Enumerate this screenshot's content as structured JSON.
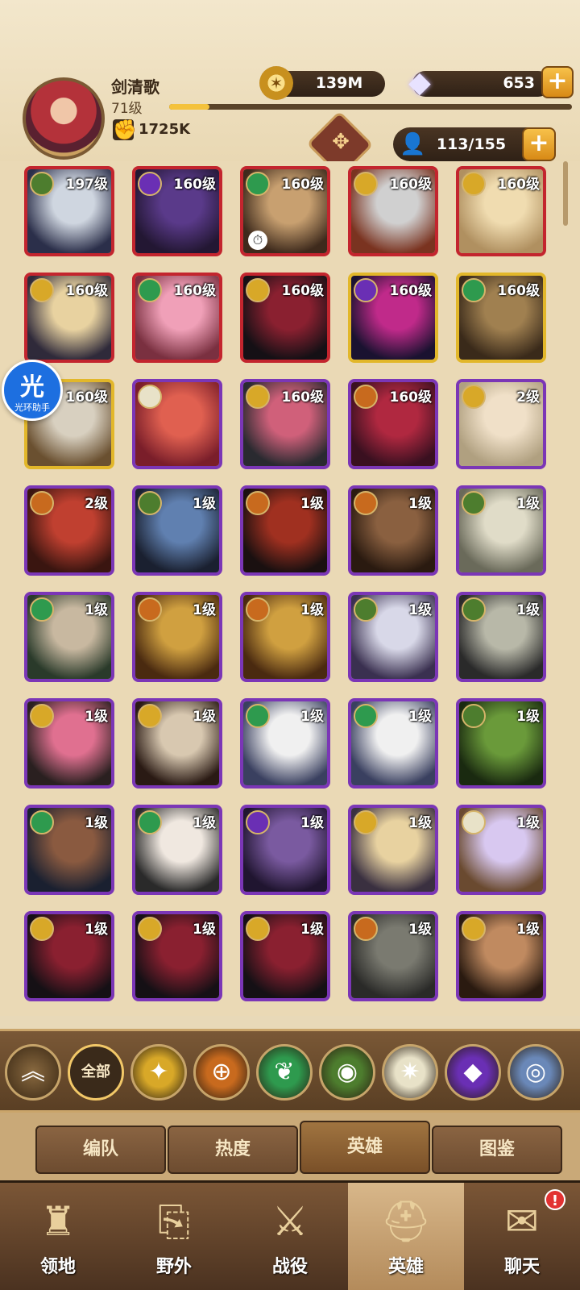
{
  "player": {
    "name": "剑清歌",
    "level": "71级",
    "xp_fraction": 0.1,
    "power": "1725K"
  },
  "currency": {
    "gold": "139M",
    "gems": "653",
    "add_glyph": "+"
  },
  "roster": {
    "capacity": "113/155",
    "add_glyph": "+"
  },
  "assistant": {
    "glyph": "光",
    "label": "光环助手"
  },
  "colors": {
    "lightbearer": "#d8a828",
    "mauler": "#c86a1e",
    "wilder": "#2e9a4e",
    "graveborn": "#4d7d2e",
    "celestial": "#e8e2c8",
    "hypogean": "#6a2fb4",
    "dimensional": "#6a88b8"
  },
  "heroes": [
    {
      "level": "197级",
      "faction": "graveborn",
      "frame": "red",
      "portrait": [
        "#cfd6e0",
        "#2b2f4a"
      ],
      "clock": false
    },
    {
      "level": "160级",
      "faction": "hypogean",
      "frame": "red",
      "portrait": [
        "#5a3a8a",
        "#231733"
      ],
      "clock": false
    },
    {
      "level": "160级",
      "faction": "wilder",
      "frame": "red",
      "portrait": [
        "#c8a070",
        "#3e2a1c"
      ],
      "clock": true
    },
    {
      "level": "160级",
      "faction": "lightbearer",
      "frame": "red",
      "portrait": [
        "#d0d0d0",
        "#7a3320"
      ],
      "clock": false
    },
    {
      "level": "160级",
      "faction": "lightbearer",
      "frame": "red",
      "portrait": [
        "#f0dcb0",
        "#b09060"
      ],
      "clock": false
    },
    {
      "level": "160级",
      "faction": "lightbearer",
      "frame": "red",
      "portrait": [
        "#e8d2a0",
        "#2f2a3a"
      ],
      "clock": false
    },
    {
      "level": "160级",
      "faction": "wilder",
      "frame": "red",
      "portrait": [
        "#f0a0b8",
        "#7a3040"
      ],
      "clock": false
    },
    {
      "level": "160级",
      "faction": "lightbearer",
      "frame": "red",
      "portrait": [
        "#8a2030",
        "#151015"
      ],
      "clock": false
    },
    {
      "level": "160级",
      "faction": "hypogean",
      "frame": "gold",
      "portrait": [
        "#c02a8a",
        "#1a1230"
      ],
      "clock": false
    },
    {
      "level": "160级",
      "faction": "wilder",
      "frame": "gold",
      "portrait": [
        "#a08050",
        "#3a2a1a"
      ],
      "clock": false
    },
    {
      "level": "160级",
      "faction": "mauler",
      "frame": "gold",
      "portrait": [
        "#d8d0c0",
        "#6a5030"
      ],
      "clock": false
    },
    {
      "level": "",
      "faction": "celestial",
      "frame": "purple",
      "portrait": [
        "#e06050",
        "#7a1e2a"
      ],
      "clock": false
    },
    {
      "level": "160级",
      "faction": "lightbearer",
      "frame": "purple",
      "portrait": [
        "#d0607a",
        "#2a2a30"
      ],
      "clock": false
    },
    {
      "level": "160级",
      "faction": "mauler",
      "frame": "purple",
      "portrait": [
        "#b02840",
        "#3a1020"
      ],
      "clock": false
    },
    {
      "level": "2级",
      "faction": "lightbearer",
      "frame": "purple",
      "portrait": [
        "#f0e0c8",
        "#b0a080"
      ],
      "clock": false
    },
    {
      "level": "2级",
      "faction": "mauler",
      "frame": "purple",
      "portrait": [
        "#c04030",
        "#3a1510"
      ],
      "clock": false
    },
    {
      "level": "1级",
      "faction": "graveborn",
      "frame": "purple",
      "portrait": [
        "#6080b0",
        "#1a2030"
      ],
      "clock": false
    },
    {
      "level": "1级",
      "faction": "mauler",
      "frame": "purple",
      "portrait": [
        "#a03020",
        "#1a1010"
      ],
      "clock": false
    },
    {
      "level": "1级",
      "faction": "mauler",
      "frame": "purple",
      "portrait": [
        "#8a6040",
        "#2a1a10"
      ],
      "clock": false
    },
    {
      "level": "1级",
      "faction": "graveborn",
      "frame": "purple",
      "portrait": [
        "#e0dcc8",
        "#6a6a5a"
      ],
      "clock": false
    },
    {
      "level": "1级",
      "faction": "wilder",
      "frame": "purple",
      "portrait": [
        "#c8b8a0",
        "#2a3a2a"
      ],
      "clock": false
    },
    {
      "level": "1级",
      "faction": "mauler",
      "frame": "purple",
      "portrait": [
        "#d0a040",
        "#4a2a10"
      ],
      "clock": false
    },
    {
      "level": "1级",
      "faction": "mauler",
      "frame": "purple",
      "portrait": [
        "#d0a040",
        "#4a2a10"
      ],
      "clock": false
    },
    {
      "level": "1级",
      "faction": "graveborn",
      "frame": "purple",
      "portrait": [
        "#d8d8e8",
        "#3a3050"
      ],
      "clock": false
    },
    {
      "level": "1级",
      "faction": "graveborn",
      "frame": "purple",
      "portrait": [
        "#b8b8a8",
        "#2a2a2a"
      ],
      "clock": false
    },
    {
      "level": "1级",
      "faction": "lightbearer",
      "frame": "purple",
      "portrait": [
        "#e07090",
        "#2a2020"
      ],
      "clock": false
    },
    {
      "level": "1级",
      "faction": "lightbearer",
      "frame": "purple",
      "portrait": [
        "#d8c8b0",
        "#2a1a14"
      ],
      "clock": false
    },
    {
      "level": "1级",
      "faction": "wilder",
      "frame": "purple",
      "portrait": [
        "#f0f0f0",
        "#3a4060"
      ],
      "clock": false
    },
    {
      "level": "1级",
      "faction": "wilder",
      "frame": "purple",
      "portrait": [
        "#f0f0f0",
        "#3a4060"
      ],
      "clock": false
    },
    {
      "level": "1级",
      "faction": "graveborn",
      "frame": "purple",
      "portrait": [
        "#6a9a3a",
        "#1a2a10"
      ],
      "clock": false
    },
    {
      "level": "1级",
      "faction": "wilder",
      "frame": "purple",
      "portrait": [
        "#8a5a40",
        "#1a2030"
      ],
      "clock": false
    },
    {
      "level": "1级",
      "faction": "wilder",
      "frame": "purple",
      "portrait": [
        "#f0e8e0",
        "#2a2a2a"
      ],
      "clock": false
    },
    {
      "level": "1级",
      "faction": "hypogean",
      "frame": "purple",
      "portrait": [
        "#7a5aa0",
        "#201530"
      ],
      "clock": false
    },
    {
      "level": "1级",
      "faction": "lightbearer",
      "frame": "purple",
      "portrait": [
        "#e8d2a0",
        "#3a3040"
      ],
      "clock": false
    },
    {
      "level": "1级",
      "faction": "celestial",
      "frame": "purple",
      "portrait": [
        "#d8c8f0",
        "#6a4a30"
      ],
      "clock": false
    },
    {
      "level": "1级",
      "faction": "lightbearer",
      "frame": "purple",
      "portrait": [
        "#8a2030",
        "#151015"
      ],
      "clock": false
    },
    {
      "level": "1级",
      "faction": "lightbearer",
      "frame": "purple",
      "portrait": [
        "#8a2030",
        "#151015"
      ],
      "clock": false
    },
    {
      "level": "1级",
      "faction": "lightbearer",
      "frame": "purple",
      "portrait": [
        "#8a2030",
        "#151015"
      ],
      "clock": false
    },
    {
      "level": "1级",
      "faction": "mauler",
      "frame": "purple",
      "portrait": [
        "#7a7a70",
        "#2a2a28"
      ],
      "clock": false
    },
    {
      "level": "1级",
      "faction": "lightbearer",
      "frame": "purple",
      "portrait": [
        "#c08a60",
        "#2a1a10"
      ],
      "clock": false
    }
  ],
  "faction_filters": [
    {
      "id": "collapse",
      "label": "",
      "glyph": "︽"
    },
    {
      "id": "all",
      "label": "全部",
      "glyph": ""
    },
    {
      "id": "lightbearer",
      "label": "",
      "glyph": "✦"
    },
    {
      "id": "mauler",
      "label": "",
      "glyph": "⊕"
    },
    {
      "id": "wilder",
      "label": "",
      "glyph": "❦"
    },
    {
      "id": "graveborn",
      "label": "",
      "glyph": "◉"
    },
    {
      "id": "celestial",
      "label": "",
      "glyph": "✷"
    },
    {
      "id": "hypogean",
      "label": "",
      "glyph": "◆"
    },
    {
      "id": "dimensional",
      "label": "",
      "glyph": "◎"
    }
  ],
  "subtabs": [
    {
      "label": "编队",
      "active": false
    },
    {
      "label": "热度",
      "active": false
    },
    {
      "label": "英雄",
      "active": true
    },
    {
      "label": "图鉴",
      "active": false
    }
  ],
  "bottom_nav": [
    {
      "label": "领地",
      "icon": "castle-icon",
      "glyph": "♜",
      "active": false,
      "badge": ""
    },
    {
      "label": "野外",
      "icon": "map-scroll-icon",
      "glyph": "⎘",
      "active": false,
      "badge": ""
    },
    {
      "label": "战役",
      "icon": "sword-shield-icon",
      "glyph": "⚔",
      "active": false,
      "badge": ""
    },
    {
      "label": "英雄",
      "icon": "helmet-icon",
      "glyph": "⛑",
      "active": true,
      "badge": ""
    },
    {
      "label": "聊天",
      "icon": "chat-icon",
      "glyph": "✉",
      "active": false,
      "badge": "!"
    }
  ]
}
